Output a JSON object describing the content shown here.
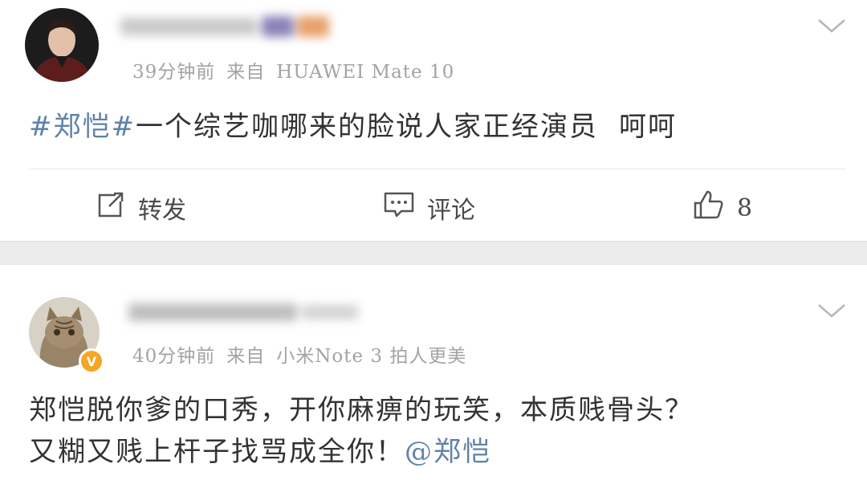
{
  "post1": {
    "time": "39分钟前",
    "source_prefix": "来自",
    "source": "HUAWEI Mate 10",
    "content": {
      "topic": "#郑恺#",
      "text": "一个综艺咖哪来的脸说人家正经演员",
      "suffix": "呵呵"
    },
    "actions": {
      "repost_label": "转发",
      "comment_label": "评论",
      "like_count": "8"
    }
  },
  "post2": {
    "time": "40分钟前",
    "source_prefix": "来自",
    "source": "小米Note 3 拍人更美",
    "content": {
      "line1": "郑恺脱你爹的口秀，开你麻痹的玩笑，本质贱骨头？",
      "line2": "又糊又贱上杆子找骂成全你！",
      "mention": "@郑恺"
    },
    "badge": "V"
  },
  "colors": {
    "link": "#5f82aa",
    "meta": "#a3a3a3",
    "text": "#333333",
    "separator": "#ececec",
    "badge": "#f5a623"
  },
  "icons": [
    "repost-icon",
    "comment-icon",
    "like-icon",
    "chevron-down-icon"
  ]
}
